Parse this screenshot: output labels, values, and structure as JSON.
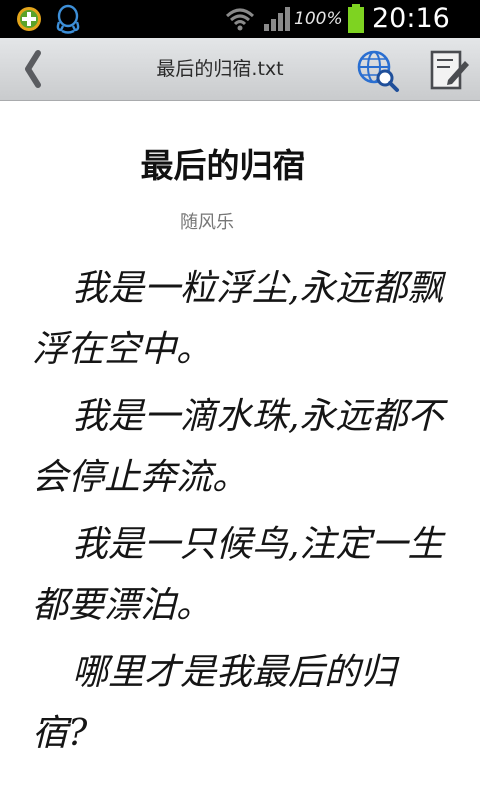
{
  "status_bar": {
    "icons": [
      "app-store-icon",
      "qq-penguin-icon",
      "wifi-icon",
      "signal-icon",
      "battery-charging-icon"
    ],
    "battery_percent": "100%",
    "time": "20:16",
    "colors": {
      "background": "#000000",
      "battery": "#7ed321",
      "text": "#ffffff"
    }
  },
  "title_bar": {
    "title": "最后的归宿.txt",
    "icons": [
      "back-chevron-icon",
      "globe-search-icon",
      "edit-note-icon"
    ],
    "colors": {
      "background": "#d6d8da",
      "accent": "#2a6fd1"
    }
  },
  "document": {
    "title": "最后的归宿",
    "author": "随风乐",
    "paragraphs": [
      "我是一粒浮尘,永远都飘浮在空中。",
      "我是一滴水珠,永远都不会停止奔流。",
      "我是一只候鸟,注定一生都要漂泊。",
      "哪里才是我最后的归宿?"
    ]
  }
}
